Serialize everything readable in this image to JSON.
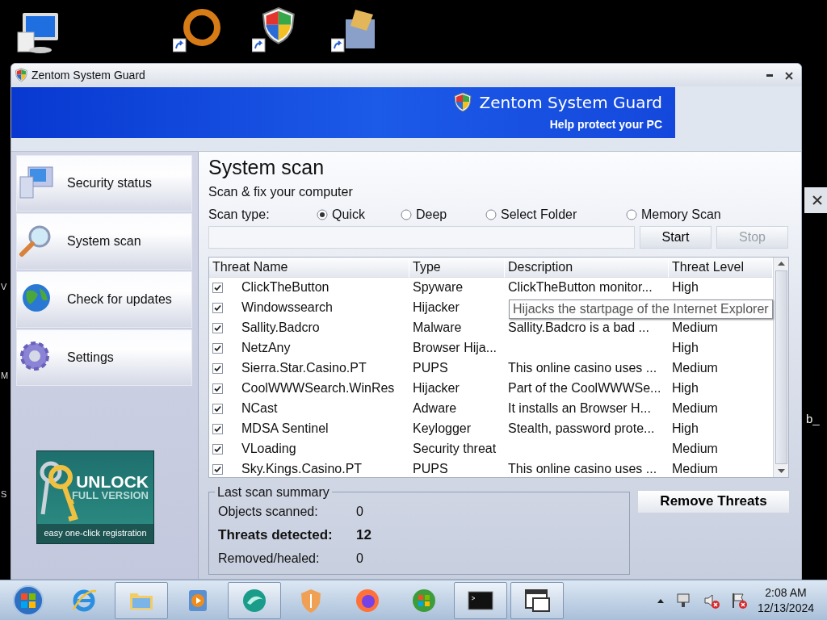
{
  "desktop": {
    "edge_letters": [
      "V",
      "M",
      "S"
    ],
    "fragment_text": "b_"
  },
  "window": {
    "title": "Zentom System Guard",
    "banner_title": "Zentom System Guard",
    "banner_subtitle": "Help protect your PC"
  },
  "sidebar": {
    "items": [
      {
        "label": "Security status"
      },
      {
        "label": "System scan"
      },
      {
        "label": "Check for updates"
      },
      {
        "label": "Settings"
      }
    ],
    "unlock": {
      "title": "UNLOCK",
      "subtitle": "FULL VERSION",
      "caption": "easy one-click registration"
    }
  },
  "scan": {
    "title": "System scan",
    "subtitle": "Scan & fix your computer",
    "scan_type_label": "Scan type:",
    "options": [
      {
        "label": "Quick",
        "selected": true
      },
      {
        "label": "Deep",
        "selected": false
      },
      {
        "label": "Select Folder",
        "selected": false
      },
      {
        "label": "Memory Scan",
        "selected": false
      }
    ],
    "progress": {
      "level": 0
    },
    "buttons": [
      {
        "label": "Start",
        "disabled": false
      },
      {
        "label": "Stop",
        "disabled": true
      }
    ]
  },
  "table": {
    "columns": [
      "Threat Name",
      "Type",
      "Description",
      "Threat Level"
    ],
    "rows": [
      {
        "checked": true,
        "name": "ClickTheButton",
        "type": "Spyware",
        "description": "ClickTheButton monitor...",
        "level": "High"
      },
      {
        "checked": true,
        "name": "Windowssearch",
        "type": "Hijacker",
        "description": "",
        "level": ""
      },
      {
        "checked": true,
        "name": "Sallity.Badcro",
        "type": "Malware",
        "description": "Sallity.Badcro is a bad ...",
        "level": "Medium"
      },
      {
        "checked": true,
        "name": "NetzAny",
        "type": "Browser Hija...",
        "description": "",
        "level": "High"
      },
      {
        "checked": true,
        "name": "Sierra.Star.Casino.PT",
        "type": "PUPS",
        "description": "This online casino uses ...",
        "level": "Medium"
      },
      {
        "checked": true,
        "name": "CoolWWWSearch.WinRes",
        "type": "Hijacker",
        "description": "Part of the CoolWWWSe...",
        "level": "High"
      },
      {
        "checked": true,
        "name": "NCast",
        "type": "Adware",
        "description": "It installs an Browser H...",
        "level": "Medium"
      },
      {
        "checked": true,
        "name": "MDSA Sentinel",
        "type": "Keylogger",
        "description": "Stealth, password prote...",
        "level": "High"
      },
      {
        "checked": true,
        "name": "VLoading",
        "type": "Security threat",
        "description": "",
        "level": "Medium"
      },
      {
        "checked": true,
        "name": "Sky.Kings.Casino.PT",
        "type": "PUPS",
        "description": "This online casino uses ...",
        "level": "Medium"
      }
    ],
    "tooltip": {
      "text": "Hijacks the startpage of the Internet Explorer"
    }
  },
  "summary": {
    "legend": "Last scan summary",
    "items": [
      {
        "label": "Objects scanned:",
        "value": "0",
        "bold": false
      },
      {
        "label": "Threats detected:",
        "value": "12",
        "bold": true
      },
      {
        "label": "Removed/healed:",
        "value": "0",
        "bold": false
      }
    ]
  },
  "remove_button": {
    "label": "Remove Threats"
  },
  "taskbar": {
    "apps": [
      {
        "running": false
      },
      {
        "running": true
      },
      {
        "running": false
      },
      {
        "running": true
      },
      {
        "running": false
      },
      {
        "running": false
      },
      {
        "running": false
      },
      {
        "running": true
      },
      {
        "running": true
      }
    ],
    "time": "2:08 AM",
    "date": "12/13/2024"
  }
}
